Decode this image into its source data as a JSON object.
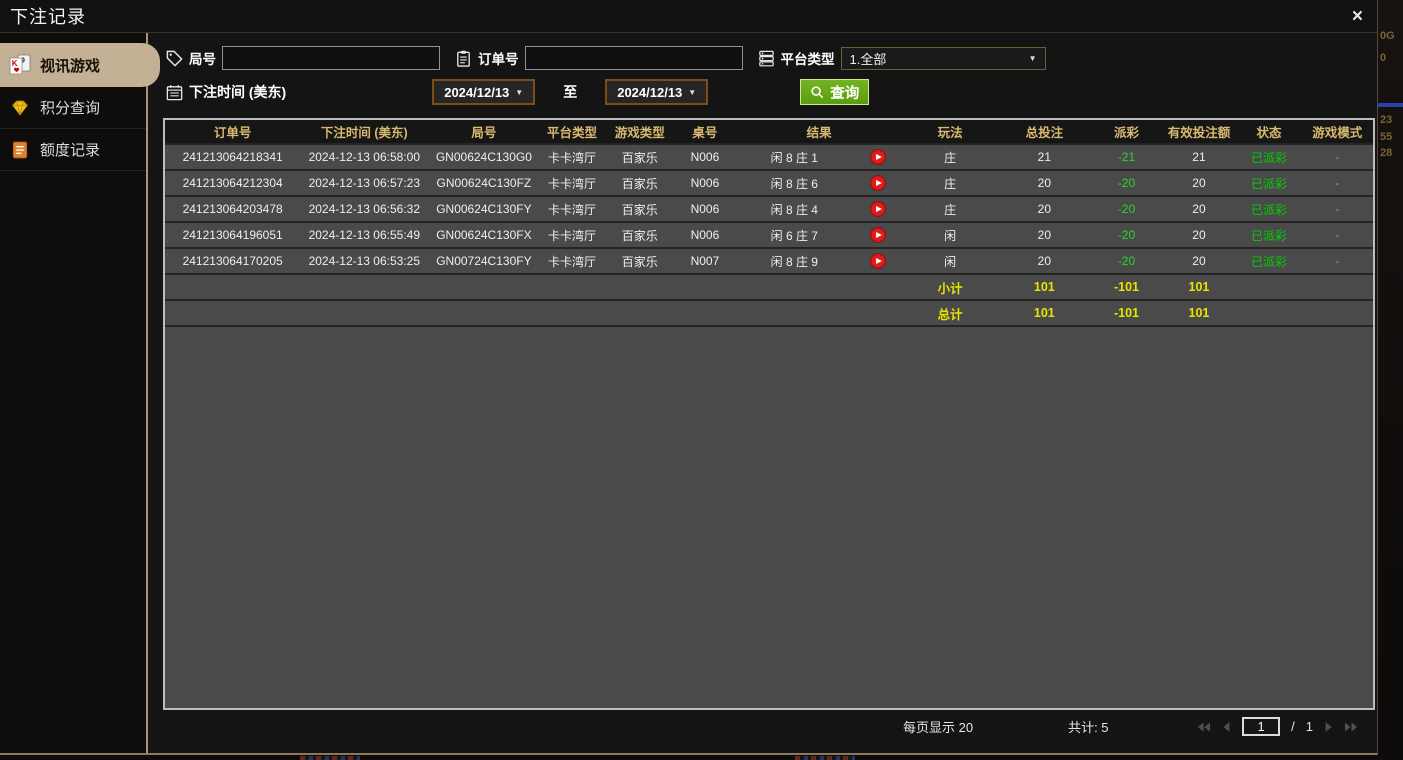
{
  "window": {
    "title": "下注记录",
    "close_glyph": "×"
  },
  "sidebar": {
    "items": [
      {
        "label": "视讯游戏",
        "icon": "playing-cards-icon",
        "active": true
      },
      {
        "label": "积分查询",
        "icon": "diamond-icon",
        "active": false
      },
      {
        "label": "额度记录",
        "icon": "document-icon",
        "active": false
      }
    ]
  },
  "filters": {
    "round_label": "局号",
    "round_value": "",
    "order_label": "订单号",
    "order_value": "",
    "platform_label": "平台类型",
    "platform_value": "1.全部",
    "time_label": "下注时间 (美东)",
    "date_from": "2024/12/13",
    "to_label": "至",
    "date_to": "2024/12/13",
    "search_label": "查询",
    "caret": "▼"
  },
  "table": {
    "columns": [
      "订单号",
      "下注时间 (美东)",
      "局号",
      "平台类型",
      "游戏类型",
      "桌号",
      "结果",
      "玩法",
      "总投注",
      "派彩",
      "有效投注额",
      "状态",
      "游戏模式"
    ],
    "rows": [
      {
        "order": "241213064218341",
        "time": "2024-12-13 06:58:00",
        "round": "GN00624C130G0",
        "platform": "卡卡湾厅",
        "game": "百家乐",
        "table_no": "N006",
        "result": "闲 8 庄 1",
        "play": "庄",
        "total_bet": "21",
        "payout": "-21",
        "valid_bet": "21",
        "status": "已派彩",
        "mode": "-"
      },
      {
        "order": "241213064212304",
        "time": "2024-12-13 06:57:23",
        "round": "GN00624C130FZ",
        "platform": "卡卡湾厅",
        "game": "百家乐",
        "table_no": "N006",
        "result": "闲 8 庄 6",
        "play": "庄",
        "total_bet": "20",
        "payout": "-20",
        "valid_bet": "20",
        "status": "已派彩",
        "mode": "-"
      },
      {
        "order": "241213064203478",
        "time": "2024-12-13 06:56:32",
        "round": "GN00624C130FY",
        "platform": "卡卡湾厅",
        "game": "百家乐",
        "table_no": "N006",
        "result": "闲 8 庄 4",
        "play": "庄",
        "total_bet": "20",
        "payout": "-20",
        "valid_bet": "20",
        "status": "已派彩",
        "mode": "-"
      },
      {
        "order": "241213064196051",
        "time": "2024-12-13 06:55:49",
        "round": "GN00624C130FX",
        "platform": "卡卡湾厅",
        "game": "百家乐",
        "table_no": "N006",
        "result": "闲 6 庄 7",
        "play": "闲",
        "total_bet": "20",
        "payout": "-20",
        "valid_bet": "20",
        "status": "已派彩",
        "mode": "-"
      },
      {
        "order": "241213064170205",
        "time": "2024-12-13 06:53:25",
        "round": "GN00724C130FY",
        "platform": "卡卡湾厅",
        "game": "百家乐",
        "table_no": "N007",
        "result": "闲 8 庄 9",
        "play": "闲",
        "total_bet": "20",
        "payout": "-20",
        "valid_bet": "20",
        "status": "已派彩",
        "mode": "-"
      }
    ],
    "subtotal": {
      "label": "小计",
      "total_bet": "101",
      "payout": "-101",
      "valid_bet": "101"
    },
    "total": {
      "label": "总计",
      "total_bet": "101",
      "payout": "-101",
      "valid_bet": "101"
    }
  },
  "footer": {
    "page_size_label": "每页显示 20",
    "total_count_label": "共计: 5",
    "page_value": "1",
    "page_separator": "/",
    "page_total": "1"
  },
  "background_edge": {
    "fragments": [
      "0G",
      "0",
      "23",
      "55",
      "28"
    ]
  },
  "colors": {
    "header_gold": "#d9b96f",
    "sum_yellow": "#e8e400",
    "payout_green": "#2ed32e",
    "status_green": "#00d000",
    "play_red": "#e21b1b",
    "active_tab_tan": "#c4b094",
    "search_green": "#63a81a",
    "date_border_brown": "#7d4e14"
  }
}
